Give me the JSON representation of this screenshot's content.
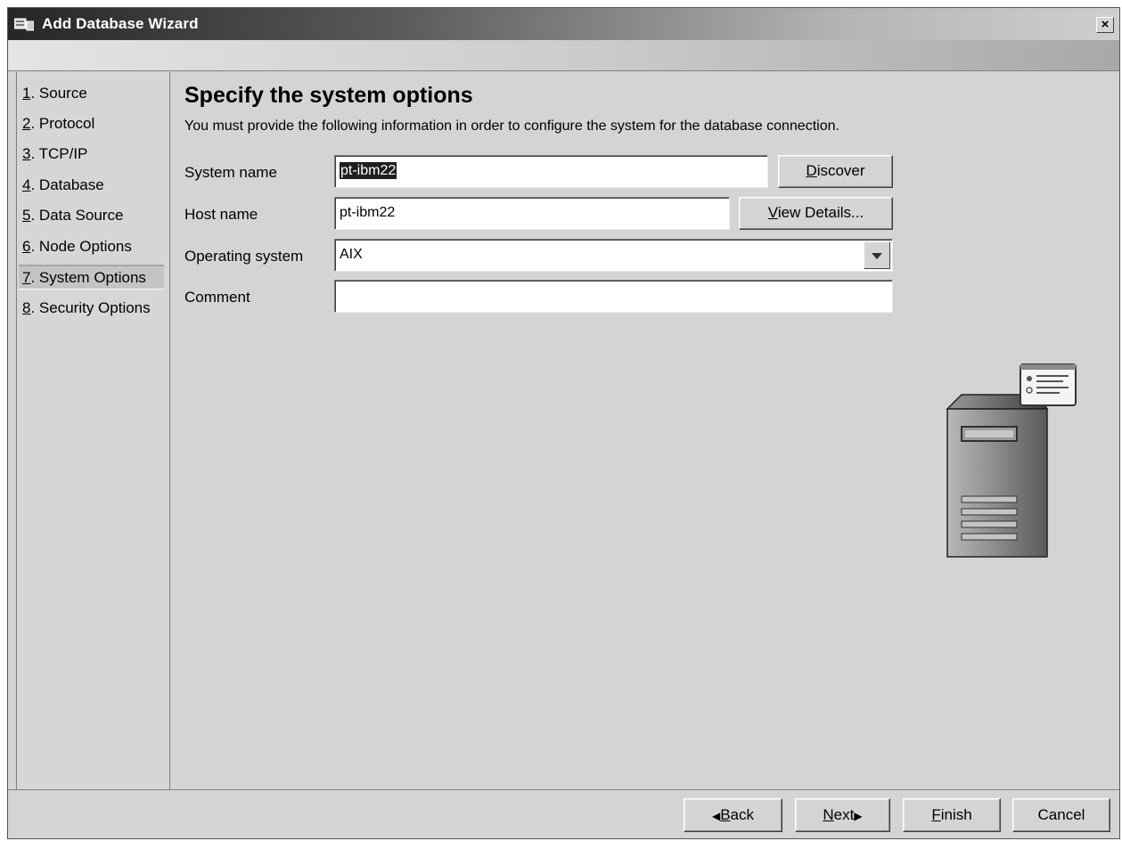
{
  "window": {
    "title": "Add Database Wizard",
    "close_glyph": "×"
  },
  "nav": {
    "items": [
      {
        "num": "1",
        "label": ". Source"
      },
      {
        "num": "2",
        "label": ". Protocol"
      },
      {
        "num": "3",
        "label": ". TCP/IP"
      },
      {
        "num": "4",
        "label": ". Database"
      },
      {
        "num": "5",
        "label": ". Data Source"
      },
      {
        "num": "6",
        "label": ". Node Options"
      },
      {
        "num": "7",
        "label": ". System Options"
      },
      {
        "num": "8",
        "label": ". Security Options"
      }
    ],
    "active_index": 6
  },
  "page": {
    "heading": "Specify the system options",
    "description": "You must provide the following information in order to configure the system for the database connection."
  },
  "form": {
    "system_name": {
      "label": "System name",
      "value": "pt-ibm22"
    },
    "host_name": {
      "label": "Host name",
      "value": "pt-ibm22"
    },
    "operating_system": {
      "label": "Operating system",
      "value": "AIX"
    },
    "comment": {
      "label": "Comment",
      "value": ""
    }
  },
  "buttons": {
    "discover": {
      "key": "D",
      "rest": "iscover"
    },
    "view_details": {
      "key": "V",
      "rest": "iew Details..."
    },
    "back": {
      "arrow": "◀",
      "key": "B",
      "rest": "ack"
    },
    "next": {
      "key": "N",
      "rest": "ext",
      "arrow": "▶"
    },
    "finish": {
      "key": "F",
      "rest": "inish"
    },
    "cancel": "Cancel"
  },
  "icons": {
    "title": "window-app-icon",
    "illustration": "server-computer-icon",
    "dropdown": "chevron-down-icon"
  }
}
